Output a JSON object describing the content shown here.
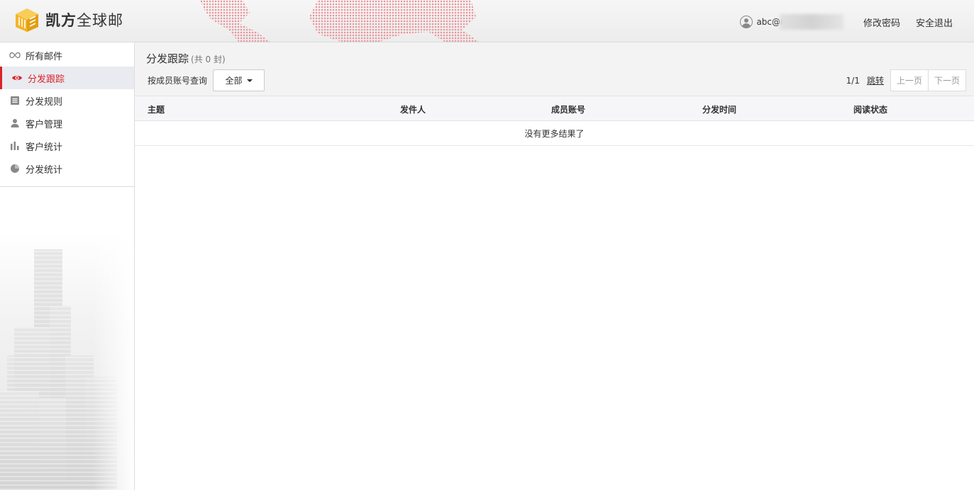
{
  "header": {
    "logo_bold": "凯方",
    "logo_rest": "全球邮",
    "user_email": "abc@r",
    "change_password": "修改密码",
    "logout": "安全退出"
  },
  "sidebar": {
    "items": [
      {
        "label": "所有邮件",
        "icon": "infinity-icon",
        "active": false
      },
      {
        "label": "分发跟踪",
        "icon": "eye-icon",
        "active": true
      },
      {
        "label": "分发规则",
        "icon": "list-icon",
        "active": false
      },
      {
        "label": "客户管理",
        "icon": "user-icon",
        "active": false
      },
      {
        "label": "客户统计",
        "icon": "bar-chart-icon",
        "active": false
      },
      {
        "label": "分发统计",
        "icon": "pie-chart-icon",
        "active": false
      }
    ]
  },
  "main": {
    "title": "分发跟踪",
    "count_text": "(共 0 封)",
    "filter_label": "按成员账号查询",
    "filter_value": "全部",
    "pager": {
      "info": "1/1",
      "jump": "跳转",
      "prev": "上一页",
      "next": "下一页"
    },
    "columns": [
      "主题",
      "发件人",
      "成员账号",
      "分发时间",
      "阅读状态"
    ],
    "empty_text": "没有更多结果了"
  },
  "colors": {
    "accent": "#d8232a",
    "active_bg": "#e9ebf1",
    "logo_orange": "#f5b427"
  }
}
